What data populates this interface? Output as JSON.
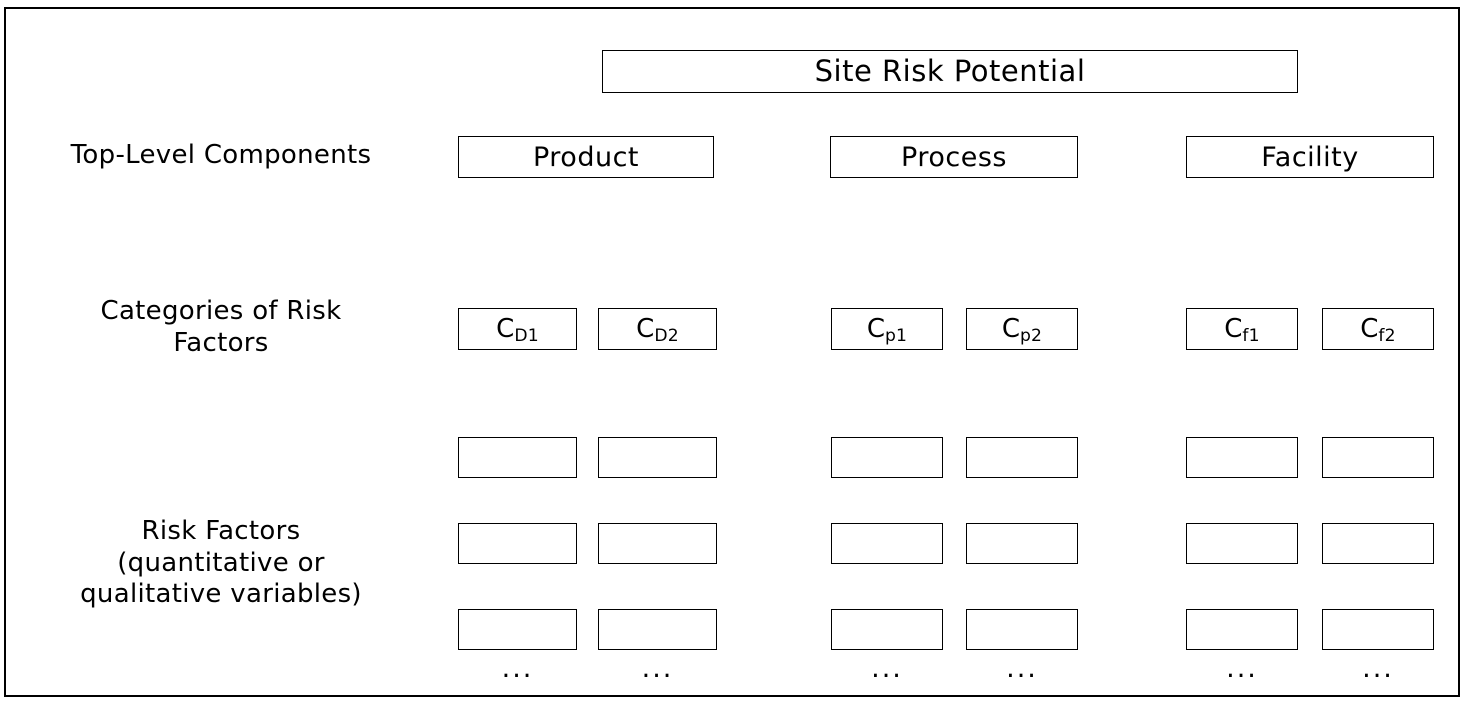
{
  "diagram": {
    "title": "Site Risk Potential",
    "root": {
      "label": "Site Risk Potential"
    },
    "row_labels": {
      "top_level": "Top-Level Components",
      "categories_line1": "Categories of Risk",
      "categories_line2": "Factors",
      "risk_factors_line1": "Risk Factors",
      "risk_factors_line2": "(quantitative or",
      "risk_factors_line3": "qualitative variables)"
    },
    "components": [
      {
        "label": "Product"
      },
      {
        "label": "Process"
      },
      {
        "label": "Facility"
      }
    ],
    "categories": [
      {
        "base": "C",
        "sub": "D1"
      },
      {
        "base": "C",
        "sub": "D2"
      },
      {
        "base": "C",
        "sub": "p1"
      },
      {
        "base": "C",
        "sub": "p2"
      },
      {
        "base": "C",
        "sub": "f1"
      },
      {
        "base": "C",
        "sub": "f2"
      }
    ],
    "factor_boxes": [
      {
        "column": "D1",
        "row": 1,
        "label": ""
      },
      {
        "column": "D1",
        "row": 2,
        "label": ""
      },
      {
        "column": "D1",
        "row": 3,
        "label": ""
      },
      {
        "column": "D2",
        "row": 1,
        "label": ""
      },
      {
        "column": "D2",
        "row": 2,
        "label": ""
      },
      {
        "column": "D2",
        "row": 3,
        "label": ""
      },
      {
        "column": "p1",
        "row": 1,
        "label": ""
      },
      {
        "column": "p1",
        "row": 2,
        "label": ""
      },
      {
        "column": "p1",
        "row": 3,
        "label": ""
      },
      {
        "column": "p2",
        "row": 1,
        "label": ""
      },
      {
        "column": "p2",
        "row": 2,
        "label": ""
      },
      {
        "column": "p2",
        "row": 3,
        "label": ""
      },
      {
        "column": "f1",
        "row": 1,
        "label": ""
      },
      {
        "column": "f1",
        "row": 2,
        "label": ""
      },
      {
        "column": "f1",
        "row": 3,
        "label": ""
      },
      {
        "column": "f2",
        "row": 1,
        "label": ""
      },
      {
        "column": "f2",
        "row": 2,
        "label": ""
      },
      {
        "column": "f2",
        "row": 3,
        "label": ""
      }
    ],
    "ellipses": [
      {
        "column": "D1",
        "text": "..."
      },
      {
        "column": "D2",
        "text": "..."
      },
      {
        "column": "p1",
        "text": "..."
      },
      {
        "column": "p2",
        "text": "..."
      },
      {
        "column": "f1",
        "text": "..."
      },
      {
        "column": "f2",
        "text": "..."
      }
    ],
    "colors": {
      "border": "#000000",
      "background": "#ffffff",
      "text": "#000000"
    }
  }
}
